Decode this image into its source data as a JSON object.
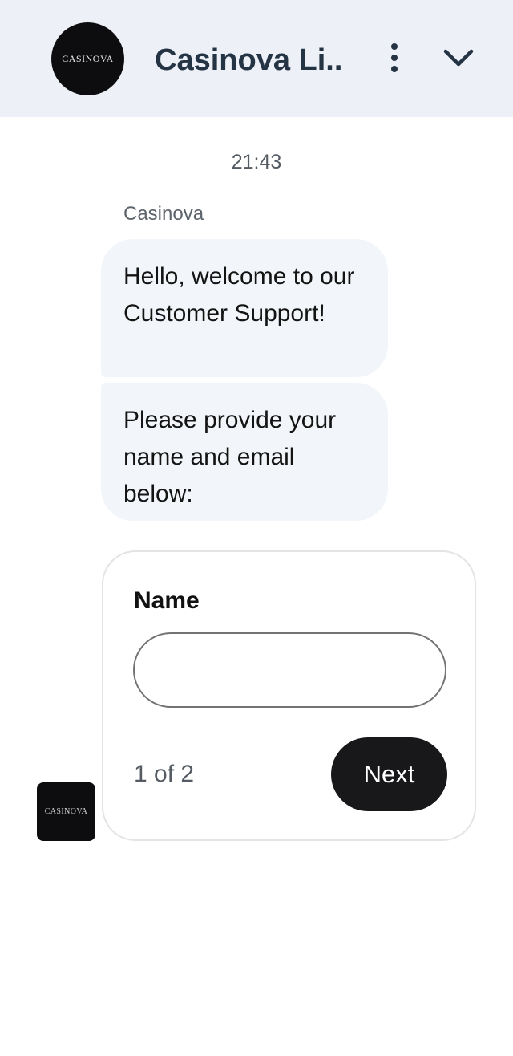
{
  "header": {
    "logo_text": "CASINOVA",
    "title": "Casinova Li...",
    "menu_icon": "more-vertical-icon",
    "collapse_icon": "chevron-down-icon"
  },
  "chat": {
    "timestamp": "21:43",
    "sender": "Casinova",
    "messages": [
      "Hello, welcome to our Customer Support!",
      "Please provide your name and email below:"
    ],
    "avatar_text": "CASINOVA"
  },
  "form": {
    "label": "Name",
    "input_value": "",
    "step_text": "1 of 2",
    "next_label": "Next"
  },
  "colors": {
    "header_bg": "#edf1f7",
    "title": "#253444",
    "bubble_bg": "#f2f5f9",
    "button_bg": "#18181b"
  }
}
